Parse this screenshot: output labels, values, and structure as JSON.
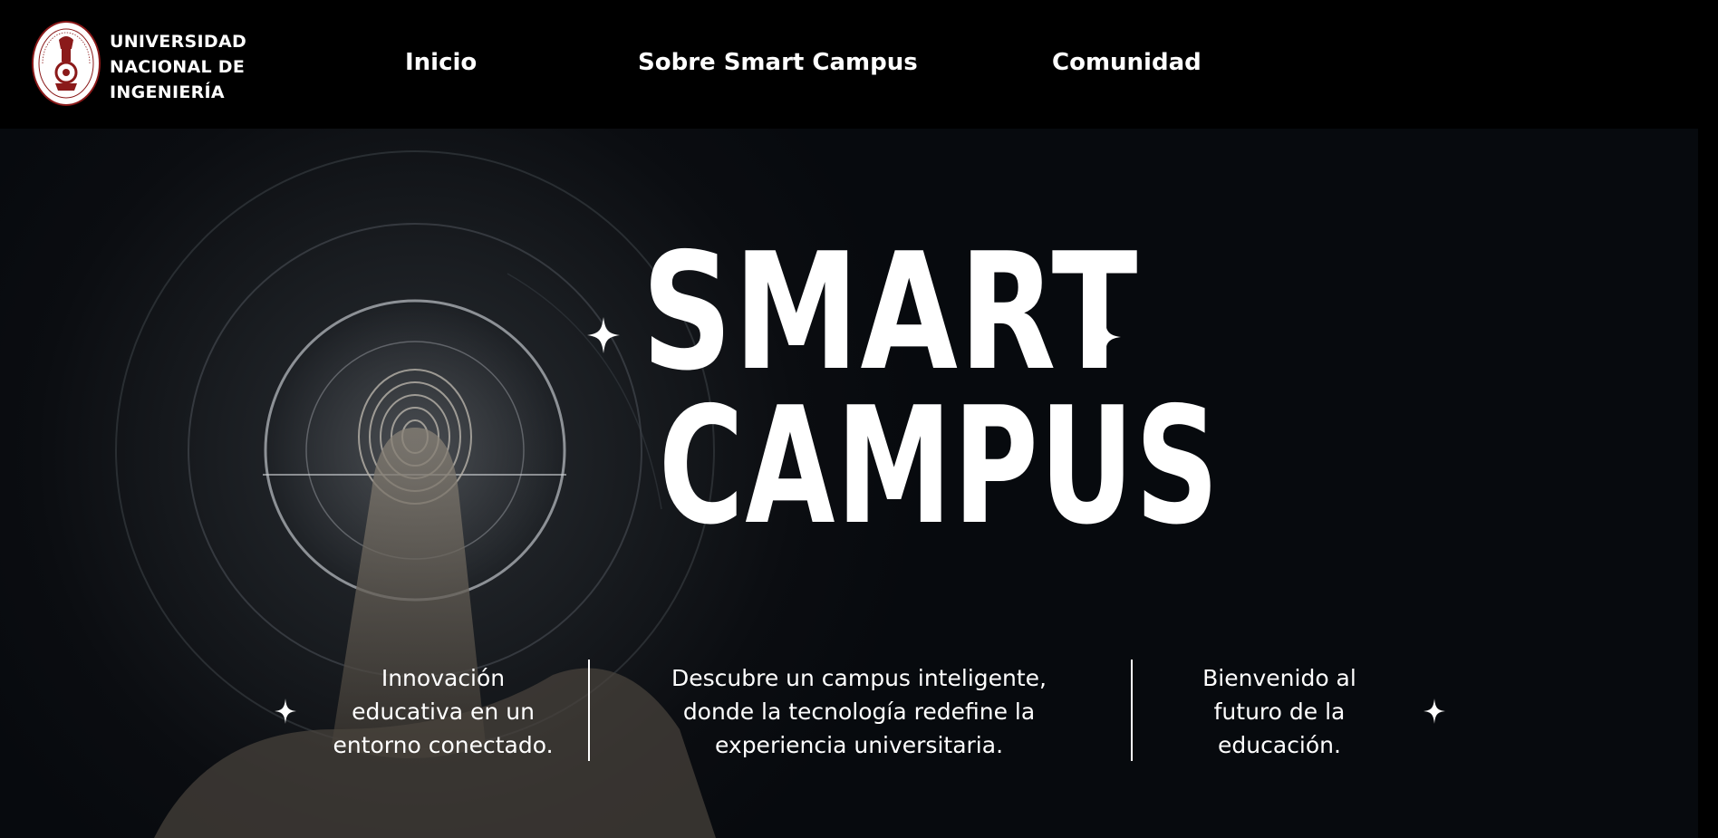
{
  "header": {
    "logo_lines": [
      "UNIVERSIDAD",
      "NACIONAL DE",
      "INGENIERÍA"
    ],
    "seal_text": "UNIVERSIDAD NACIONAL DE INGENIERÍA · LIMA 1876",
    "nav": [
      {
        "label": "Inicio"
      },
      {
        "label": "Sobre Smart Campus"
      },
      {
        "label": "Comunidad"
      }
    ]
  },
  "hero": {
    "title_line1": "SMART",
    "title_line2": "CAMPUS",
    "taglines": [
      "Innovación educativa en un entorno conectado.",
      "Descubre un campus inteligente, donde la tecnología redefine la experiencia universitaria.",
      "Bienvenido al futuro de la educación."
    ],
    "background_image": "fingertip-touching-digital-fingerprint-scanner"
  },
  "colors": {
    "background": "#000000",
    "hero_bg": "#070a0e",
    "seal_red": "#8b1a1a",
    "text": "#ffffff"
  }
}
